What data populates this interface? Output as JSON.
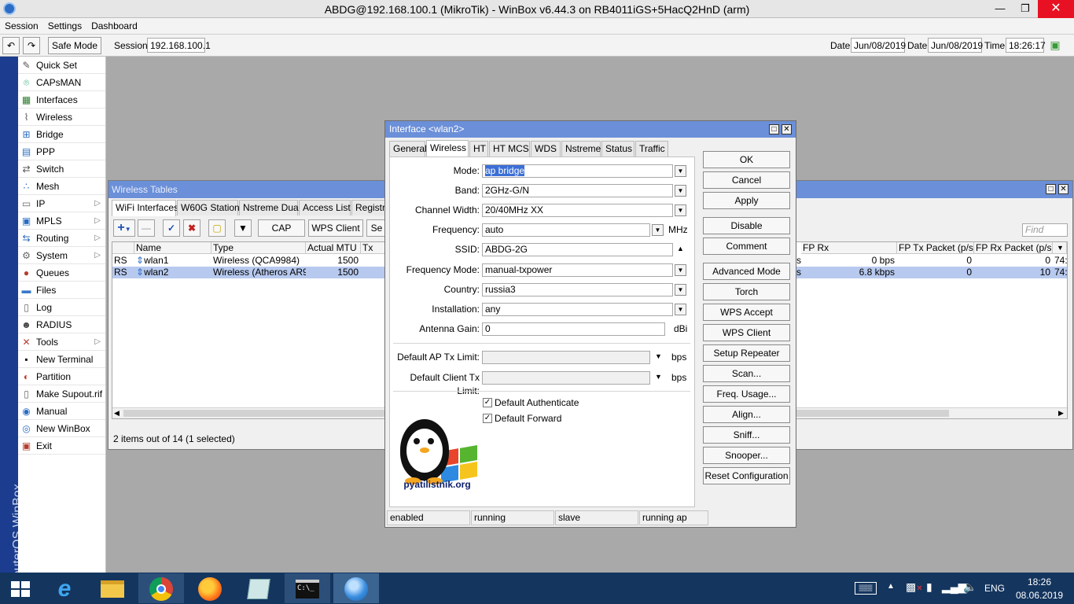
{
  "window": {
    "title": "ABDG@192.168.100.1 (MikroTik) - WinBox v6.44.3 on RB4011iGS+5HacQ2HnD (arm)"
  },
  "menu": [
    "Session",
    "Settings",
    "Dashboard"
  ],
  "toolbar": {
    "safe_mode": "Safe Mode",
    "session_label": "Session:",
    "session_value": "192.168.100.1",
    "date_label1": "Date:",
    "date_value1": "Jun/08/2019",
    "date_label2": "Date:",
    "date_value2": "Jun/08/2019",
    "time_label": "Time:",
    "time_value": "18:26:17"
  },
  "brand_vertical": "RouterOS WinBox",
  "sidebar": [
    {
      "label": "Quick Set",
      "icon": "quick-set-icon",
      "glyph": "✎",
      "color": "#555"
    },
    {
      "label": "CAPsMAN",
      "icon": "capsman-icon",
      "glyph": "⌾",
      "color": "#2a6"
    },
    {
      "label": "Interfaces",
      "icon": "interfaces-icon",
      "glyph": "▦",
      "color": "#2a7a2a"
    },
    {
      "label": "Wireless",
      "icon": "wireless-icon",
      "glyph": "⌇",
      "color": "#555"
    },
    {
      "label": "Bridge",
      "icon": "bridge-icon",
      "glyph": "⊞",
      "color": "#2b6cc4"
    },
    {
      "label": "PPP",
      "icon": "ppp-icon",
      "glyph": "▤",
      "color": "#2b6cc4"
    },
    {
      "label": "Switch",
      "icon": "switch-icon",
      "glyph": "⇄",
      "color": "#555"
    },
    {
      "label": "Mesh",
      "icon": "mesh-icon",
      "glyph": "∴",
      "color": "#2b6cc4"
    },
    {
      "label": "IP",
      "icon": "ip-icon",
      "glyph": "▭",
      "color": "#666",
      "sub": true
    },
    {
      "label": "MPLS",
      "icon": "mpls-icon",
      "glyph": "▣",
      "color": "#2b6cc4",
      "sub": true
    },
    {
      "label": "Routing",
      "icon": "routing-icon",
      "glyph": "⇆",
      "color": "#2b6cc4",
      "sub": true
    },
    {
      "label": "System",
      "icon": "system-icon",
      "glyph": "⚙",
      "color": "#666",
      "sub": true
    },
    {
      "label": "Queues",
      "icon": "queues-icon",
      "glyph": "●",
      "color": "#b53d2e"
    },
    {
      "label": "Files",
      "icon": "files-icon",
      "glyph": "▬",
      "color": "#3a78c9"
    },
    {
      "label": "Log",
      "icon": "log-icon",
      "glyph": "▯",
      "color": "#666"
    },
    {
      "label": "RADIUS",
      "icon": "radius-icon",
      "glyph": "☻",
      "color": "#444"
    },
    {
      "label": "Tools",
      "icon": "tools-icon",
      "glyph": "✕",
      "color": "#b53d2e",
      "sub": true
    },
    {
      "label": "New Terminal",
      "icon": "terminal-icon",
      "glyph": "▪",
      "color": "#111"
    },
    {
      "label": "Partition",
      "icon": "partition-icon",
      "glyph": "◐",
      "color": "#c0392b"
    },
    {
      "label": "Make Supout.rif",
      "icon": "supout-icon",
      "glyph": "▯",
      "color": "#666"
    },
    {
      "label": "Manual",
      "icon": "manual-icon",
      "glyph": "◉",
      "color": "#2b6cc4"
    },
    {
      "label": "New WinBox",
      "icon": "new-winbox-icon",
      "glyph": "◎",
      "color": "#2b6cc4"
    },
    {
      "label": "Exit",
      "icon": "exit-icon",
      "glyph": "▣",
      "color": "#b53d2e"
    }
  ],
  "wireless_tables": {
    "title": "Wireless Tables",
    "tabs": [
      "WiFi Interfaces",
      "W60G Station",
      "Nstreme Dual",
      "Access List",
      "Registra"
    ],
    "buttons": {
      "cap": "CAP",
      "wps_client": "WPS Client",
      "setup": "Se"
    },
    "find_placeholder": "Find",
    "columns_left": [
      "",
      "Name",
      "Type",
      "Actual MTU",
      "Tx"
    ],
    "columns_right": [
      "FP Rx",
      "FP Tx Packet (p/s)",
      "FP Rx Packet (p/s)"
    ],
    "rows": [
      {
        "flags": "RS",
        "name": "wlan1",
        "type": "Wireless (QCA9984)",
        "mtu": "1500",
        "rtail": "s",
        "fp_rx": "0 bps",
        "fp_tx_pkt": "0",
        "fp_rx_pkt": "0",
        "extra": "74:",
        "selected": false
      },
      {
        "flags": "RS",
        "name": "wlan2",
        "type": "Wireless (Atheros AR9...",
        "mtu": "1500",
        "rtail": "s",
        "fp_rx": "6.8 kbps",
        "fp_tx_pkt": "0",
        "fp_rx_pkt": "10",
        "extra": "74:",
        "selected": true
      }
    ],
    "status": "2 items out of 14 (1 selected)"
  },
  "dialog": {
    "title": "Interface <wlan2>",
    "tabs": [
      "General",
      "Wireless",
      "HT",
      "HT MCS",
      "WDS",
      "Nstreme",
      "Status",
      "Traffic"
    ],
    "active_tab": "Wireless",
    "fields": {
      "mode": {
        "label": "Mode:",
        "value": "ap bridge"
      },
      "band": {
        "label": "Band:",
        "value": "2GHz-G/N"
      },
      "channel_width": {
        "label": "Channel Width:",
        "value": "20/40MHz XX"
      },
      "frequency": {
        "label": "Frequency:",
        "value": "auto",
        "unit": "MHz"
      },
      "ssid": {
        "label": "SSID:",
        "value": "ABDG-2G"
      },
      "frequency_mode": {
        "label": "Frequency Mode:",
        "value": "manual-txpower"
      },
      "country": {
        "label": "Country:",
        "value": "russia3"
      },
      "installation": {
        "label": "Installation:",
        "value": "any"
      },
      "antenna_gain": {
        "label": "Antenna Gain:",
        "value": "0",
        "unit": "dBi"
      },
      "ap_tx_limit": {
        "label": "Default AP Tx Limit:",
        "value": "",
        "unit": "bps"
      },
      "client_tx_limit": {
        "label": "Default Client Tx Limit:",
        "value": "",
        "unit": "bps"
      }
    },
    "checks": [
      {
        "label": "Default Authenticate",
        "checked": true
      },
      {
        "label": "Default Forward",
        "checked": true
      }
    ],
    "logo_text": "pyatilistnik.org",
    "buttons": [
      "OK",
      "Cancel",
      "Apply",
      "Disable",
      "Comment",
      "Advanced Mode",
      "Torch",
      "WPS Accept",
      "WPS Client",
      "Setup Repeater",
      "Scan...",
      "Freq. Usage...",
      "Align...",
      "Sniff...",
      "Snooper...",
      "Reset Configuration"
    ],
    "status": [
      "enabled",
      "running",
      "slave",
      "running ap"
    ]
  },
  "taskbar": {
    "lang": "ENG",
    "time": "18:26",
    "date": "08.06.2019"
  },
  "colors": {
    "accent": "#6b8fd8",
    "sidebar_bar": "#1c3d8f",
    "selection": "#b7c9ee"
  }
}
